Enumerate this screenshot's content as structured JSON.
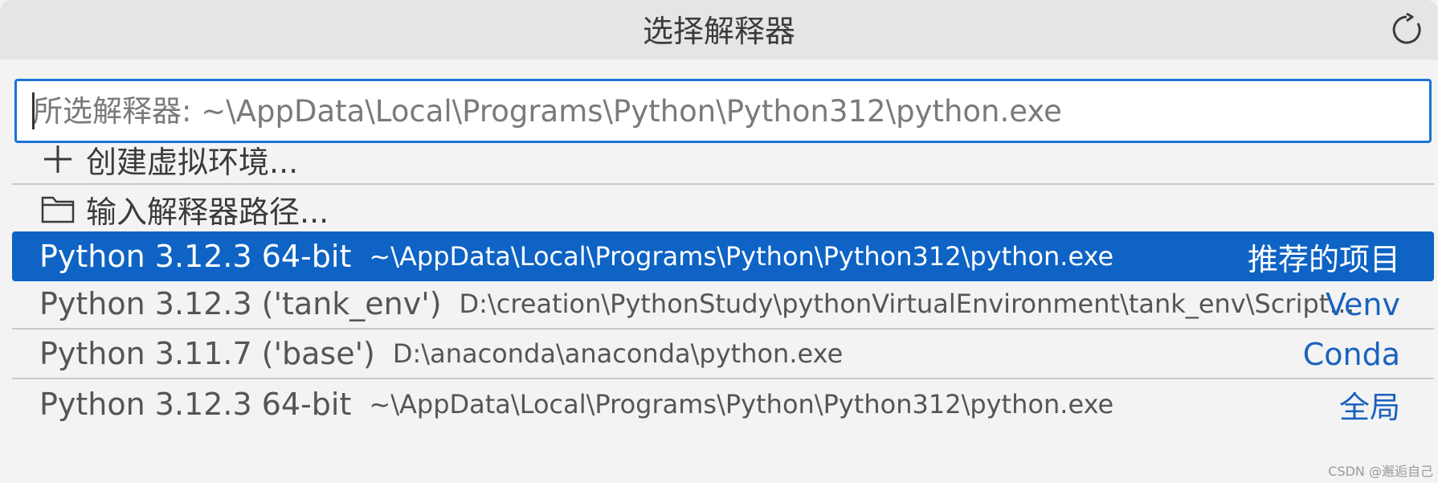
{
  "dialog": {
    "title": "选择解释器",
    "refresh_icon": "refresh-icon"
  },
  "search": {
    "placeholder": "所选解释器: ~\\AppData\\Local\\Programs\\Python\\Python312\\python.exe",
    "value": ""
  },
  "actions": [
    {
      "icon": "plus-icon",
      "label": "创建虚拟环境..."
    },
    {
      "icon": "folder-icon",
      "label": "输入解释器路径..."
    }
  ],
  "interpreters": [
    {
      "label": "Python 3.12.3 64-bit",
      "path": "~\\AppData\\Local\\Programs\\Python\\Python312\\python.exe",
      "tag": "推荐的项目",
      "selected": true
    },
    {
      "label": "Python 3.12.3 ('tank_env')",
      "path": "D:\\creation\\PythonStudy\\pythonVirtualEnvironment\\tank_env\\Scripts\\p...",
      "tag": "Venv",
      "selected": false
    },
    {
      "label": "Python 3.11.7 ('base')",
      "path": "D:\\anaconda\\anaconda\\python.exe",
      "tag": "Conda",
      "selected": false
    },
    {
      "label": "Python 3.12.3 64-bit",
      "path": "~\\AppData\\Local\\Programs\\Python\\Python312\\python.exe",
      "tag": "全局",
      "selected": false
    }
  ],
  "watermark": "CSDN @邂逅自己",
  "colors": {
    "accent": "#0e63c4",
    "focus_border": "#1a73d4",
    "tag_text": "#1a62bf",
    "background": "#f3f3f3",
    "titlebar": "#e5e5e5"
  }
}
